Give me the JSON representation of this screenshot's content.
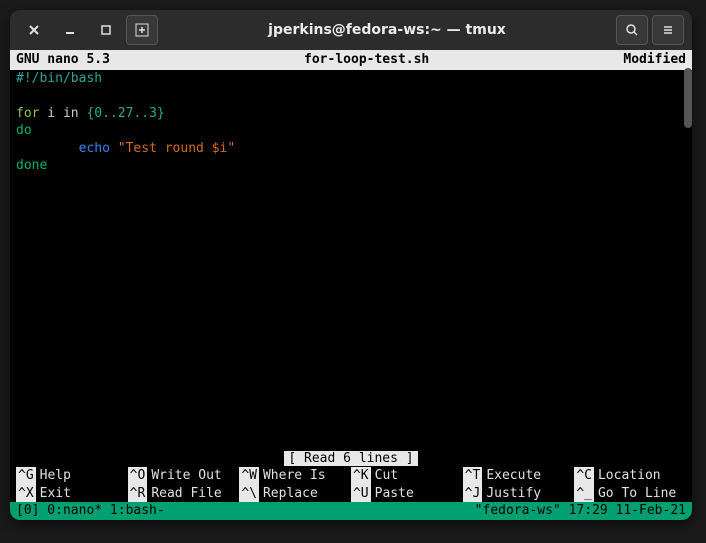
{
  "titlebar": {
    "title": "jperkins@fedora-ws:~ — tmux"
  },
  "nano": {
    "app": "GNU nano 5.3",
    "filename": "for-loop-test.sh",
    "status": "Modified",
    "read_msg": "[ Read 6 lines ]"
  },
  "code": {
    "shebang": "#!/bin/bash",
    "for_kw": "for",
    "for_rest": " i in ",
    "for_range": "{0..27..3}",
    "do_kw": "do",
    "echo_indent": "        ",
    "echo_kw": "echo",
    "echo_str": " \"Test round $i\"",
    "done_kw": "done"
  },
  "shortcuts": [
    {
      "key": "^G",
      "label": "Help"
    },
    {
      "key": "^O",
      "label": "Write Out"
    },
    {
      "key": "^W",
      "label": "Where Is"
    },
    {
      "key": "^K",
      "label": "Cut"
    },
    {
      "key": "^T",
      "label": "Execute"
    },
    {
      "key": "^C",
      "label": "Location"
    },
    {
      "key": "^X",
      "label": "Exit"
    },
    {
      "key": "^R",
      "label": "Read File"
    },
    {
      "key": "^\\",
      "label": "Replace"
    },
    {
      "key": "^U",
      "label": "Paste"
    },
    {
      "key": "^J",
      "label": "Justify"
    },
    {
      "key": "^_",
      "label": "Go To Line"
    }
  ],
  "tmux": {
    "left": "[0] 0:nano* 1:bash-",
    "host": "\"fedora-ws\"",
    "time": "17:29 11-Feb-21"
  }
}
